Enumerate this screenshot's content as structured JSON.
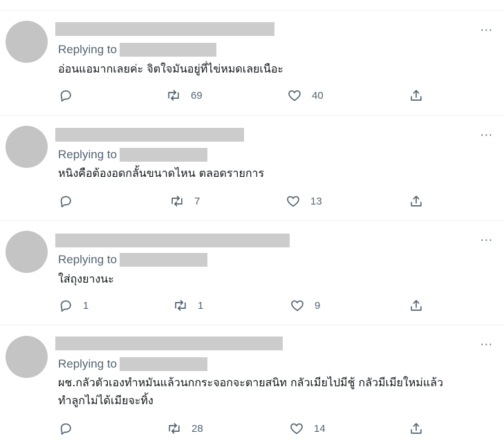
{
  "colors": {
    "text": "#0f1419",
    "secondary": "#536471",
    "divider": "#eff3f4",
    "placeholder": "#cccccc"
  },
  "icons": {
    "reply": "reply-icon",
    "retweet": "retweet-icon",
    "like": "heart-icon",
    "share": "share-icon",
    "more": "more-icon"
  },
  "tweets": [
    {
      "replying_label": "Replying to",
      "text": "อ่อนแอมากเลยค่ะ จิตใจมันอยู่ที่ไข่หมดเลยเนือะ",
      "replies": "",
      "retweets": "69",
      "likes": "40",
      "more": "···"
    },
    {
      "replying_label": "Replying to",
      "text": "หนิงคือต้องอดกลั้นขนาดไหน ตลอดรายการ",
      "replies": "",
      "retweets": "7",
      "likes": "13",
      "more": "···"
    },
    {
      "replying_label": "Replying to",
      "text": "ใส่ถุงยางนะ",
      "replies": "1",
      "retweets": "1",
      "likes": "9",
      "more": "···"
    },
    {
      "replying_label": "Replying to",
      "text": "ผช.กลัวตัวเองทำหมันแล้วนกกระจอกจะตายสนิท กลัวเมียไปมีชู้ กลัวมีเมียใหม่แล้ว",
      "text_line2": "ทำลูกไม่ได้เมียจะทิ้ง",
      "replies": "",
      "retweets": "28",
      "likes": "14",
      "more": "···"
    }
  ]
}
